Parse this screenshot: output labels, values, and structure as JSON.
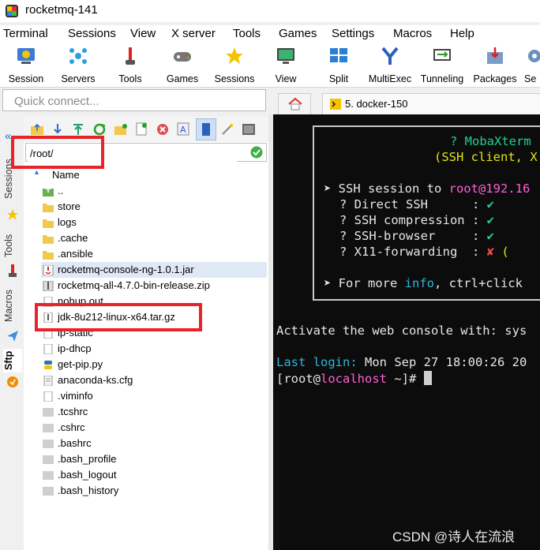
{
  "window": {
    "title": "rocketmq-141"
  },
  "menu": [
    "Terminal",
    "Sessions",
    "View",
    "X server",
    "Tools",
    "Games",
    "Settings",
    "Macros",
    "Help"
  ],
  "toolbar": [
    {
      "label": "Session",
      "icon": "session-icon"
    },
    {
      "label": "Servers",
      "icon": "servers-icon"
    },
    {
      "label": "Tools",
      "icon": "tools-icon"
    },
    {
      "label": "Games",
      "icon": "games-icon"
    },
    {
      "label": "Sessions",
      "icon": "sessions-star-icon"
    },
    {
      "label": "View",
      "icon": "view-icon"
    },
    {
      "label": "Split",
      "icon": "split-icon"
    },
    {
      "label": "MultiExec",
      "icon": "multiexec-icon"
    },
    {
      "label": "Tunneling",
      "icon": "tunneling-icon"
    },
    {
      "label": "Packages",
      "icon": "packages-icon"
    },
    {
      "label": "Se",
      "icon": "settings-icon"
    }
  ],
  "quick_connect": {
    "placeholder": "Quick connect..."
  },
  "session_tab": {
    "label": "5. docker-150"
  },
  "side_tabs": [
    "Sessions",
    "Tools",
    "Macros",
    "Sftp"
  ],
  "sftp": {
    "path": "/root/",
    "column_header": "Name",
    "files": [
      {
        "name": "..",
        "type": "parent"
      },
      {
        "name": "store",
        "type": "folder"
      },
      {
        "name": "logs",
        "type": "folder"
      },
      {
        "name": ".cache",
        "type": "folder"
      },
      {
        "name": ".ansible",
        "type": "folder"
      },
      {
        "name": "rocketmq-console-ng-1.0.1.jar",
        "type": "jar",
        "selected": true
      },
      {
        "name": "rocketmq-all-4.7.0-bin-release.zip",
        "type": "zip"
      },
      {
        "name": "nohup.out",
        "type": "file"
      },
      {
        "name": "jdk-8u212-linux-x64.tar.gz",
        "type": "archive"
      },
      {
        "name": "ip-static",
        "type": "file"
      },
      {
        "name": "ip-dhcp",
        "type": "file"
      },
      {
        "name": "get-pip.py",
        "type": "python"
      },
      {
        "name": "anaconda-ks.cfg",
        "type": "cfg"
      },
      {
        "name": ".viminfo",
        "type": "file"
      },
      {
        "name": ".tcshrc",
        "type": "hidden"
      },
      {
        "name": ".cshrc",
        "type": "hidden"
      },
      {
        "name": ".bashrc",
        "type": "hidden"
      },
      {
        "name": ".bash_profile",
        "type": "hidden"
      },
      {
        "name": ".bash_logout",
        "type": "hidden"
      },
      {
        "name": ".bash_history",
        "type": "hidden"
      }
    ]
  },
  "terminal": {
    "banner_title": "? MobaXterm",
    "banner_subtitle": "(SSH client, X",
    "session_prefix": "➤ SSH session to ",
    "session_host": "root@192.16",
    "features": [
      {
        "label": "? Direct SSH      : ",
        "mark": "✔",
        "ok": true
      },
      {
        "label": "? SSH compression : ",
        "mark": "✔",
        "ok": true
      },
      {
        "label": "? SSH-browser     : ",
        "mark": "✔",
        "ok": true
      },
      {
        "label": "? X11-forwarding  : ",
        "mark": "✘",
        "ok": false,
        "suffix": " ("
      }
    ],
    "info_prefix": "➤ For more ",
    "info_word": "info",
    "info_suffix": ", ctrl+click",
    "activate_line": "Activate the web console with: sys",
    "last_login_label": "Last login:",
    "last_login_value": " Mon Sep 27 18:00:26 20",
    "prompt_open": "[root@",
    "prompt_host": "localhost",
    "prompt_close": " ~]# "
  },
  "watermark": "CSDN @诗人在流浪",
  "colors": {
    "green": "#23d18b",
    "pink": "#ff5fd7",
    "cyan": "#29b8db",
    "yellow": "#e5e510",
    "red_annotation": "#e8232a"
  }
}
